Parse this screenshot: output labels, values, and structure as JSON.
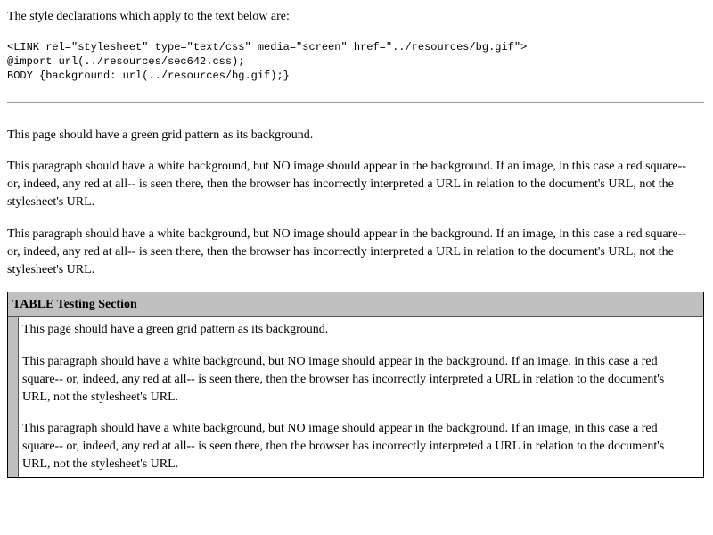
{
  "intro": "The style declarations which apply to the text below are:",
  "code_lines": [
    "<LINK rel=\"stylesheet\" type=\"text/css\" media=\"screen\" href=\"../resources/bg.gif\">",
    "@import url(../resources/sec642.css);",
    "BODY {background: url(../resources/bg.gif);}"
  ],
  "paragraphs": [
    "This page should have a green grid pattern as its background.",
    "This paragraph should have a white background, but NO image should appear in the background. If an image, in this case a red square-- or, indeed, any red at all-- is seen there, then the browser has incorrectly interpreted a URL in relation to the document's URL, not the stylesheet's URL.",
    "This paragraph should have a white background, but NO image should appear in the background. If an image, in this case a red square-- or, indeed, any red at all-- is seen there, then the browser has incorrectly interpreted a URL in relation to the document's URL, not the stylesheet's URL."
  ],
  "table": {
    "header": "TABLE Testing Section",
    "paragraphs": [
      "This page should have a green grid pattern as its background.",
      "This paragraph should have a white background, but NO image should appear in the background. If an image, in this case a red square-- or, indeed, any red at all-- is seen there, then the browser has incorrectly interpreted a URL in relation to the document's URL, not the stylesheet's URL.",
      "This paragraph should have a white background, but NO image should appear in the background. If an image, in this case a red square-- or, indeed, any red at all-- is seen there, then the browser has incorrectly interpreted a URL in relation to the document's URL, not the stylesheet's URL."
    ]
  },
  "colors": {
    "header_gray": "#c0c0c0",
    "rule_gray": "#999999"
  }
}
